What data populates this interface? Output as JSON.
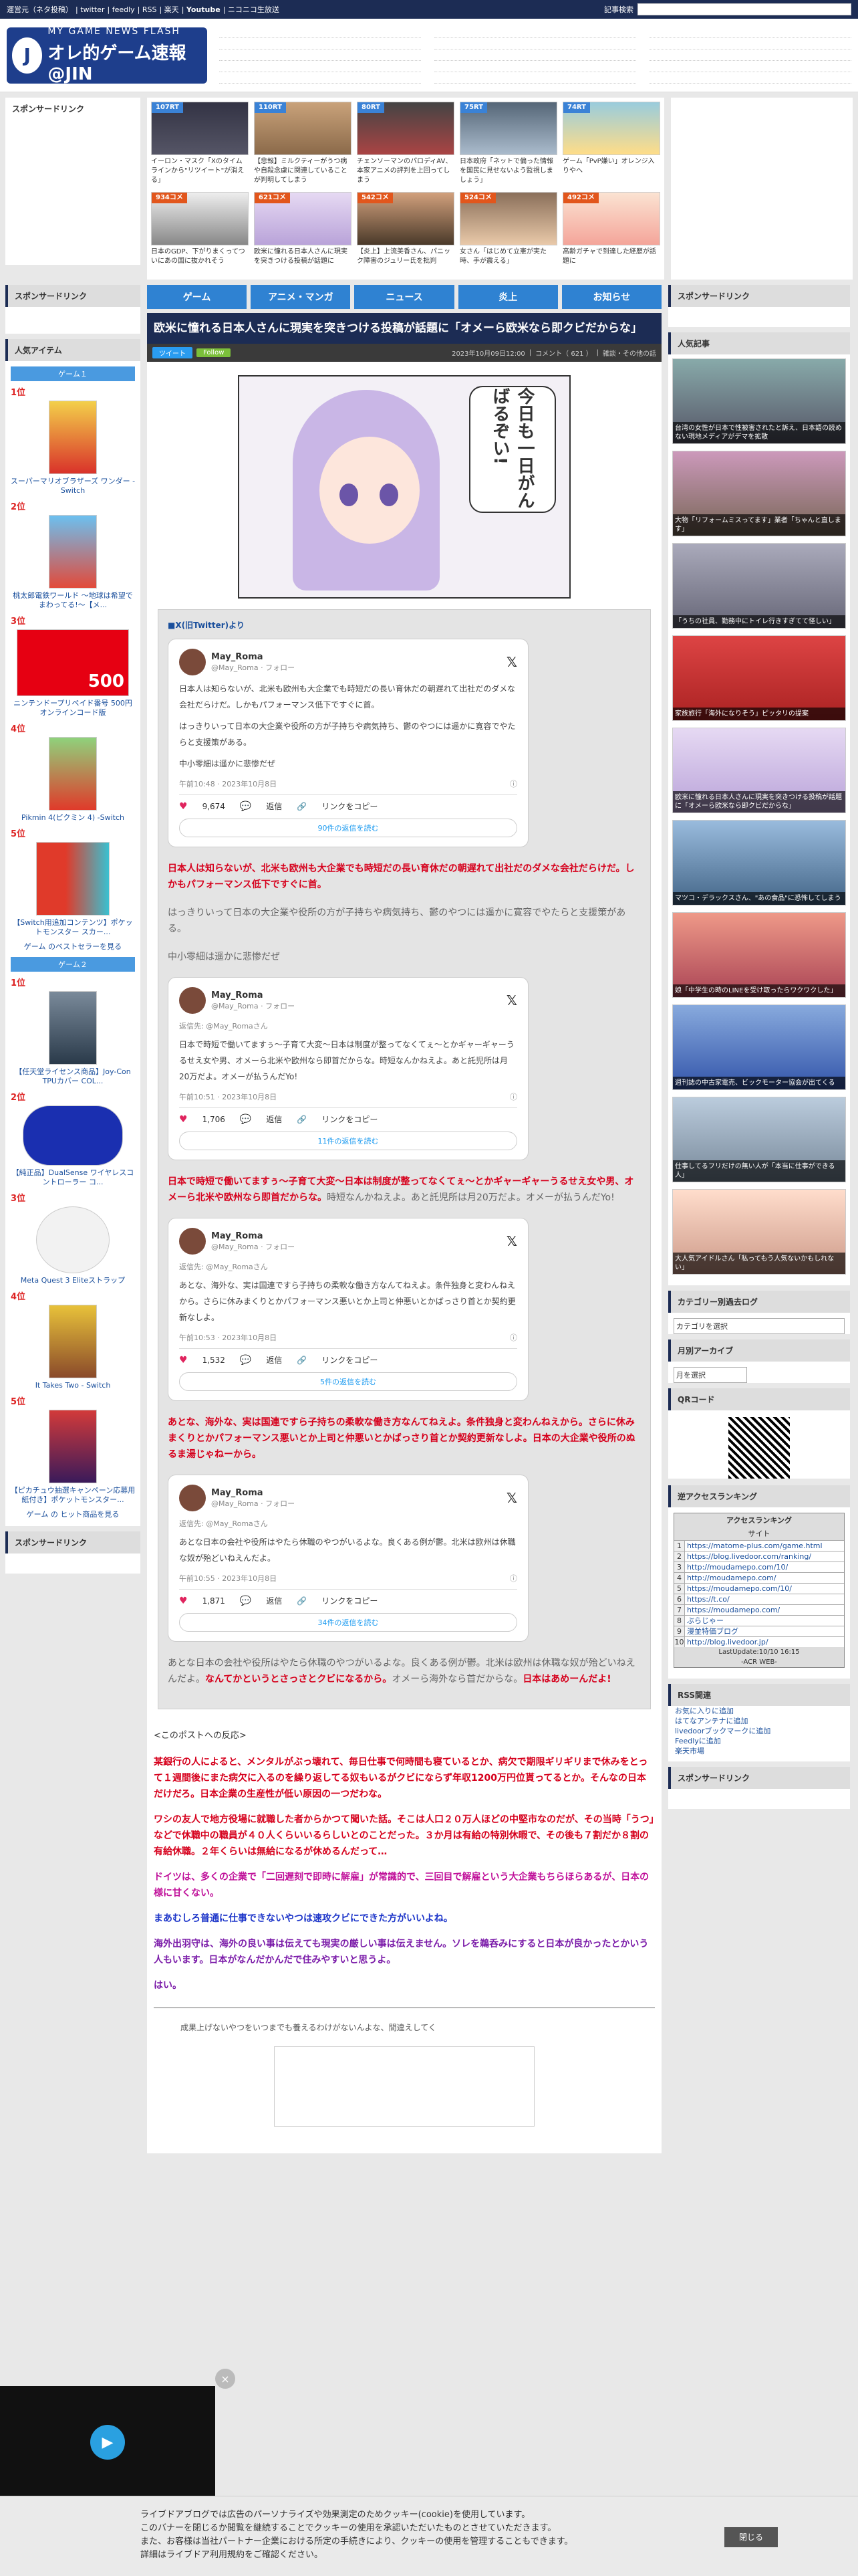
{
  "topbar": {
    "links": [
      "運営元（ネタ投稿）",
      "twitter",
      "feedly",
      "RSS",
      "楽天",
      "Youtube",
      "ニコニコ生放送"
    ],
    "search_label": "記事検索"
  },
  "header": {
    "logo_line1": "MY GAME NEWS FLASH",
    "logo_line2": "オレ的ゲーム速報@JIN"
  },
  "thumbs": [
    {
      "tag": "107RT",
      "text": "イーロン・マスク「Xのタイムラインから\"リツイート\"が消える」"
    },
    {
      "tag": "110RT",
      "text": "【悲報】ミルクティーがうつ病や自殺念慮に関連していることが判明してしまう"
    },
    {
      "tag": "80RT",
      "text": "チェンソーマンのパロディAV、本家アニメの評判を上回ってしまう"
    },
    {
      "tag": "75RT",
      "text": "日本政府「ネットで偏った情報を国民に見せないよう監視しましょう」"
    },
    {
      "tag": "74RT",
      "text": "ゲーム「PvP嫌い」オレンジ入りやへ"
    },
    {
      "tag": "934コメ",
      "text": "日本のGDP、下がりまくってついにあの国に抜かれそう"
    },
    {
      "tag": "621コメ",
      "text": "欧米に憧れる日本人さんに現実を突きつける投稿が話題に"
    },
    {
      "tag": "542コメ",
      "text": "【炎上】上流美香さん、パニック障害のジュリー氏を批判"
    },
    {
      "tag": "524コメ",
      "text": "女さん「はじめて立憲が実た時、手が震える」"
    },
    {
      "tag": "492コメ",
      "text": "高齢ガチャで到達した経歴が話題に"
    }
  ],
  "nav": [
    "ゲーム",
    "アニメ・マンガ",
    "ニュース",
    "炎上",
    "お知らせ"
  ],
  "sidebar_left": {
    "sponsor": "スポンサードリンク",
    "popular_items": "人気アイテム",
    "game1": "ゲーム１",
    "game2": "ゲーム２",
    "items1": [
      {
        "rank": "1位",
        "name": "スーパーマリオブラザーズ ワンダー -Switch"
      },
      {
        "rank": "2位",
        "name": "桃太郎電鉄ワールド ～地球は希望でまわってる!～【メ..."
      },
      {
        "rank": "3位",
        "name": "ニンテンドープリペイド番号 500円 オンラインコード版"
      },
      {
        "rank": "4位",
        "name": "Pikmin 4(ピクミン 4) -Switch"
      },
      {
        "rank": "5位",
        "name": "【Switch用追加コンテンツ】ポケットモンスター スカー..."
      }
    ],
    "more1": "ゲーム のベストセラーを見る",
    "items2": [
      {
        "rank": "1位",
        "name": "【任天堂ライセンス商品】Joy-Con TPUカバー COL..."
      },
      {
        "rank": "2位",
        "name": "【純正品】DualSense ワイヤレスコントローラー コ..."
      },
      {
        "rank": "3位",
        "name": "Meta Quest 3 Eliteストラップ"
      },
      {
        "rank": "4位",
        "name": "It Takes Two - Switch"
      },
      {
        "rank": "5位",
        "name": "【ピカチュウ抽選キャンペーン応募用紙付き】ポケットモンスター..."
      }
    ],
    "more2": "ゲーム の ヒット商品を見る",
    "sponsor2": "スポンサードリンク"
  },
  "article": {
    "title": "欧米に憧れる日本人さんに現実を突きつける投稿が話題に「オメーら欧米なら即クビだからな」",
    "tweet_btn": "ツイート",
    "follow_btn": "Follow",
    "date": "2023年10月09日12:00",
    "comments": "コメント（ 621 ）",
    "category": "雑談・その他の話",
    "bubble": "今日も一日がんばるぞい!",
    "source": "■X(旧Twitter)より",
    "tweets": [
      {
        "name": "May_Roma",
        "handle": "@May_Roma · フォロー",
        "reply": "",
        "text": [
          "日本人は知らないが、北米も欧州も大企業でも時短だの長い育休だの朝遅れて出社だのダメな会社だらけだ。しかもパフォーマンス低下ですぐに首。",
          "はっきりいって日本の大企業や役所の方が子持ちや病気持ち、鬱のやつには遥かに寛容でやたらと支援策がある。",
          "中小零細は遥かに悲惨だぜ"
        ],
        "time": "午前10:48 · 2023年10月8日",
        "likes": "9,674",
        "reply_label": "返信",
        "share_label": "リンクをコピー",
        "more": "90件の返信を読む"
      },
      {
        "name": "May_Roma",
        "handle": "@May_Roma · フォロー",
        "reply": "返信先: @May_Romaさん",
        "text": [
          "日本で時短で働いてますぅ〜子育て大変〜日本は制度が整ってなくてぇ〜とかギャーギャーうるせえ女や男、オメーら北米や欧州なら即首だからな。時短なんかねえよ。あと託児所は月20万だよ。オメーが払うんだYo!"
        ],
        "time": "午前10:51 · 2023年10月8日",
        "likes": "1,706",
        "reply_label": "返信",
        "share_label": "リンクをコピー",
        "more": "11件の返信を読む"
      },
      {
        "name": "May_Roma",
        "handle": "@May_Roma · フォロー",
        "reply": "返信先: @May_Romaさん",
        "text": [
          "あとな、海外な、実は国連ですら子持ちの柔軟な働き方なんてねえよ。条件独身と変わんねえから。さらに休みまくりとかパフォーマンス悪いとか上司と仲悪いとかばっさり首とか契約更新なしよ。"
        ],
        "time": "午前10:53 · 2023年10月8日",
        "likes": "1,532",
        "reply_label": "返信",
        "share_label": "リンクをコピー",
        "more": "5件の返信を読む"
      },
      {
        "name": "May_Roma",
        "handle": "@May_Roma · フォロー",
        "reply": "返信先: @May_Romaさん",
        "text": [
          "あとな日本の会社や役所はやたら休職のやつがいるよな。良くある例が鬱。北米は欧州は休職な奴が殆どいねえんだよ。"
        ],
        "time": "午前10:55 · 2023年10月8日",
        "likes": "1,871",
        "reply_label": "返信",
        "share_label": "リンクをコピー",
        "more": "34件の返信を読む"
      }
    ],
    "p1_red": "日本人は知らないが、北米も欧州も大企業でも時短だの長い育休だの朝遅れて出社だのダメな会社だらけだ。しかもパフォーマンス低下ですぐに首。",
    "p1_gray": "はっきりいって日本の大企業や役所の方が子持ちや病気持ち、鬱のやつには遥かに寛容でやたらと支援策がある。",
    "p1_gray2": "中小零細は遥かに悲惨だぜ",
    "p2_red": "日本で時短で働いてますぅ〜子育て大変〜日本は制度が整ってなくてぇ〜とかギャーギャーうるせえ女や男、オメーら北米や欧州なら即首だからな。",
    "p2_gray": "時短なんかねえよ。あと託児所は月20万だよ。オメーが払うんだYo!",
    "p3_red": "あとな、海外な、実は国連ですら子持ちの柔軟な働き方なんてねえよ。条件独身と変わんねえから。さらに休みまくりとかパフォーマンス悪いとか上司と仲悪いとかばっさり首とか契約更新なしよ。日本の大企業や役所のぬるま湯じゃねーから。",
    "p4_gray": "あとな日本の会社や役所はやたら休職のやつがいるよな。良くある例が鬱。北米は欧州は休職な奴が殆どいねえんだよ。",
    "p4_red": "なんてかというとさっさとクビになるから。",
    "p4_gray2": "オメーら海外なら首だからな。",
    "p4_red2": "日本はあめーんだよ!",
    "reaction_head": "<このポストへの反応>",
    "reactions": [
      {
        "c": "r",
        "t": "某銀行の人によると、メンタルがぶっ壊れて、毎日仕事で何時間も寝ているとか、病欠で期限ギリギリまで休みをとって１週間後にまた病欠に入るのを繰り返してる奴もいるがクビにならず年収1200万円位貰ってるとか。そんなの日本だけだろ。日本企業の生産性が低い原因の一つだわな。"
      },
      {
        "c": "r",
        "t": "ワシの友人で地方役場に就職した者からかつて聞いた話。そこは人口２０万人ほどの中堅市なのだが、その当時「うつ」などで休職中の職員が４０人くらいいるらしいとのことだった。３か月は有給の特別休暇で、その後も７割だか８割の有給休職。２年くらいは無給になるが休めるんだって…"
      },
      {
        "c": "m",
        "t": "ドイツは、多くの企業で「二回遅刻で即時に解雇」が常識的で、三回目で解雇という大企業もちらほらあるが、日本の様に甘くない。"
      },
      {
        "c": "b",
        "t": "まあむしろ普通に仕事できないやつは速攻クビにできた方がいいよね。"
      },
      {
        "c": "p",
        "t": "海外出羽守は、海外の良い事は伝えても現実の厳しい事は伝えません。ソレを鵜呑みにすると日本が良かったとかいう人もいます。日本がなんだかんだで住みやすいと思うよ。"
      },
      {
        "c": "p",
        "t": "はい。"
      }
    ],
    "footnote": "成果上げないやつをいつまでも養えるわけがないんよな、間違えしてく"
  },
  "sidebar_right": {
    "sponsor": "スポンサードリンク",
    "popular": "人気記事",
    "pop_items": [
      "台湾の女性が日本で性被害されたと訴え、日本語の読めない現地メディアがデマを拡散",
      "大物「リフォームミスってます」業者「ちゃんと直します」",
      "「うちの社員、勤務中にトイレ行きすぎてて怪しい」",
      "家族旅行「海外になりそう」ピッタリの提案",
      "欧米に憧れる日本人さんに現実を突きつける投稿が話題に「オメーら欧米なら即クビだからな」",
      "マツコ・デラックスさん、\"あの食品\"に恐怖してしまう",
      "娘「中学生の時のLINEを受け取ったらワクワクした」",
      "週刊誌の中古家電売、ビックモーター協会が出てくる",
      "仕事してるフリだけの無い人が「本当に仕事ができる人」",
      "大人気アイドルさん「私ってもう人気ないかもしれない」"
    ],
    "cat_head": "カテゴリー別過去ログ",
    "cat_select": "カテゴリを選択",
    "month_head": "月別アーカイブ",
    "month_select": "月を選択",
    "qr_head": "QRコード",
    "rank_head": "逆アクセスランキング",
    "rank_th": "アクセスランキング",
    "rank_th2": "サイト",
    "rank_rows": [
      "https://matome-plus.com/game.html",
      "https://blog.livedoor.com/ranking/",
      "http://moudamepo.com/10/",
      "http://moudamepo.com/",
      "https://moudamepo.com/10/",
      "https://t.co/",
      "https://moudamepo.com/",
      "ぶらじゃー",
      "漫並特価ブログ",
      "http://blog.livedoor.jp/"
    ],
    "rank_footer": "LastUpdate:10/10 16:15",
    "rank_footer2": "-ACR WEB-",
    "rss_head": "RSS関連",
    "rss_links": [
      "お気に入りに追加",
      "はてなアンテナに追加",
      "livedoorブックマークに追加",
      "Feedlyに追加",
      "楽天市場"
    ],
    "sponsor2": "スポンサードリンク"
  },
  "cookie": {
    "line1": "ライブドアブログでは広告のパーソナライズや効果測定のためクッキー(cookie)を使用しています。",
    "line2": "このバナーを閉じるか閲覧を継続することでクッキーの使用を承認いただいたものとさせていただきます。",
    "line3": "また、お客様は当社パートナー企業における所定の手続きにより、クッキーの使用を管理することもできます。",
    "line4": "詳細はライブドア利用規約をご確認ください。",
    "close": "閉じる"
  },
  "video": {
    "close": "×"
  }
}
